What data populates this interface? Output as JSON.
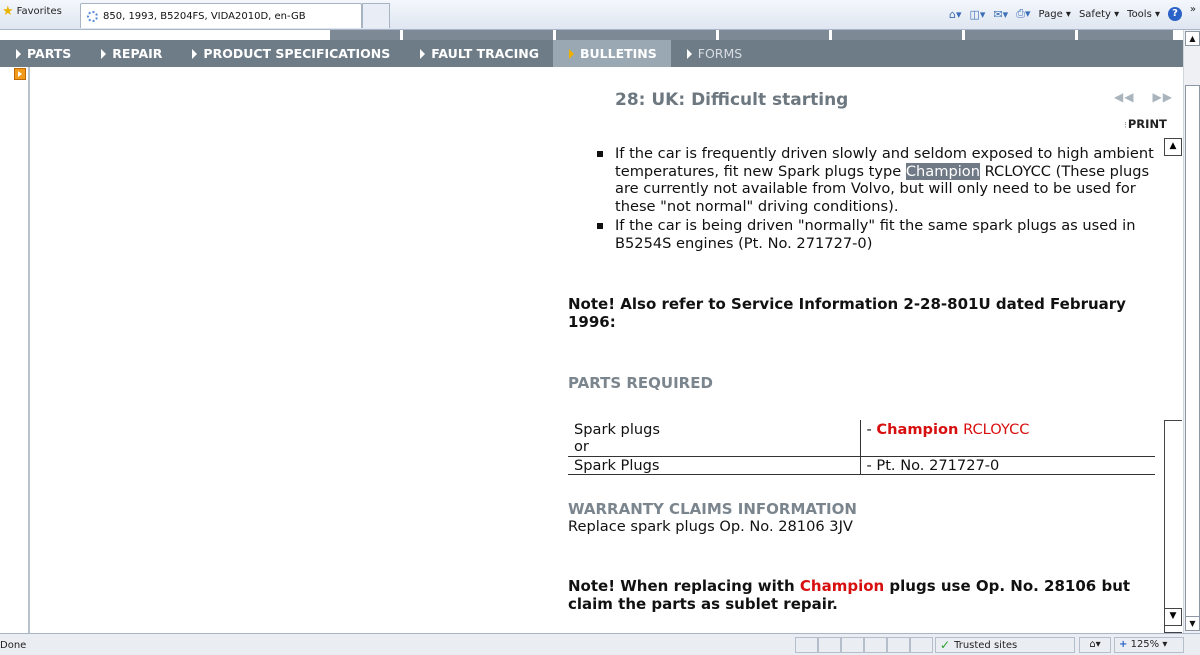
{
  "browser": {
    "favorites_label": "Favorites",
    "tab_title": "850, 1993, B5204FS, VIDA2010D, en-GB",
    "tools": [
      "Page",
      "Safety",
      "Tools"
    ],
    "status_text": "Done",
    "zone": "Trusted sites",
    "zoom": "125%"
  },
  "upper_tabs": [
    "",
    "",
    "",
    "",
    "",
    "",
    ""
  ],
  "nav": {
    "items": [
      {
        "label": "PARTS",
        "state": "normal"
      },
      {
        "label": "REPAIR",
        "state": "normal"
      },
      {
        "label": "PRODUCT SPECIFICATIONS",
        "state": "normal"
      },
      {
        "label": "FAULT TRACING",
        "state": "normal"
      },
      {
        "label": "BULLETINS",
        "state": "active"
      },
      {
        "label": "FORMS",
        "state": "dim"
      }
    ]
  },
  "document": {
    "title": "28: UK: Difficult starting",
    "print_label": "PRINT",
    "bullet1": {
      "before": "If the car is frequently driven slowly and seldom exposed to high ambient temperatures, fit new Spark plugs type ",
      "highlight": "Champion",
      "after": " RCLOYCC (These plugs are currently not available from Volvo, but will only need to be used for these \"not normal\" driving conditions)."
    },
    "bullet2": "If the car is being driven \"normally\" fit the same spark plugs as used in B5254S engines (Pt. No. 271727-0)",
    "note1": "Note! Also refer to Service Information 2-28-801U dated February 1996:",
    "parts_heading": "PARTS REQUIRED",
    "parts_table": {
      "row1": {
        "name": "Spark plugs",
        "prefix": "- ",
        "brand": "Champion",
        "code": " RCLOYCC"
      },
      "row2": {
        "name": "or"
      },
      "row3": {
        "name": "Spark Plugs",
        "value": "- Pt. No. 271727-0"
      }
    },
    "warranty_heading": "WARRANTY CLAIMS INFORMATION",
    "warranty_text": "Replace spark plugs Op. No. 28106 3JV",
    "note2": {
      "before": "Note! When replacing with ",
      "brand": "Champion",
      "after": " plugs use Op. No. 28106 but claim the parts as sublet repair."
    }
  },
  "colors": {
    "nav_bg": "#6e7c88",
    "nav_active": "#9aa8b3",
    "heading_grey": "#7b858e",
    "champion_red": "#d80f0f",
    "highlight_bg": "#707a86"
  }
}
